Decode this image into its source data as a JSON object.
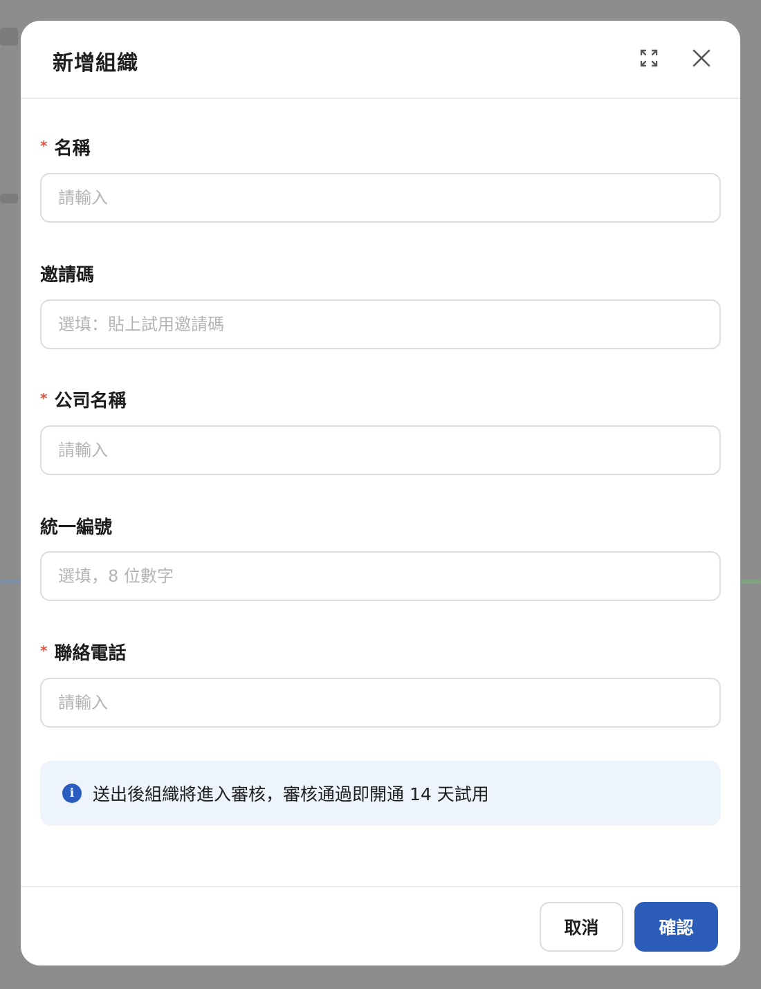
{
  "dialog": {
    "title": "新增組織"
  },
  "form": {
    "fields": [
      {
        "label": "名稱",
        "required": true,
        "placeholder": "請輸入",
        "value": ""
      },
      {
        "label": "邀請碼",
        "required": false,
        "placeholder": "選填：貼上試用邀請碼",
        "value": ""
      },
      {
        "label": "公司名稱",
        "required": true,
        "placeholder": "請輸入",
        "value": ""
      },
      {
        "label": "統一編號",
        "required": false,
        "placeholder": "選填，8 位數字",
        "value": ""
      },
      {
        "label": "聯絡電話",
        "required": true,
        "placeholder": "請輸入",
        "value": ""
      }
    ],
    "required_mark": "*"
  },
  "notice": {
    "icon": "info-icon",
    "icon_glyph": "i",
    "text": "送出後組織將進入審核，審核通過即開通 14 天試用"
  },
  "footer": {
    "cancel_label": "取消",
    "confirm_label": "確認"
  },
  "colors": {
    "primary": "#2b5db8",
    "required": "#e0533d",
    "notice_bg": "#eef4fc"
  }
}
